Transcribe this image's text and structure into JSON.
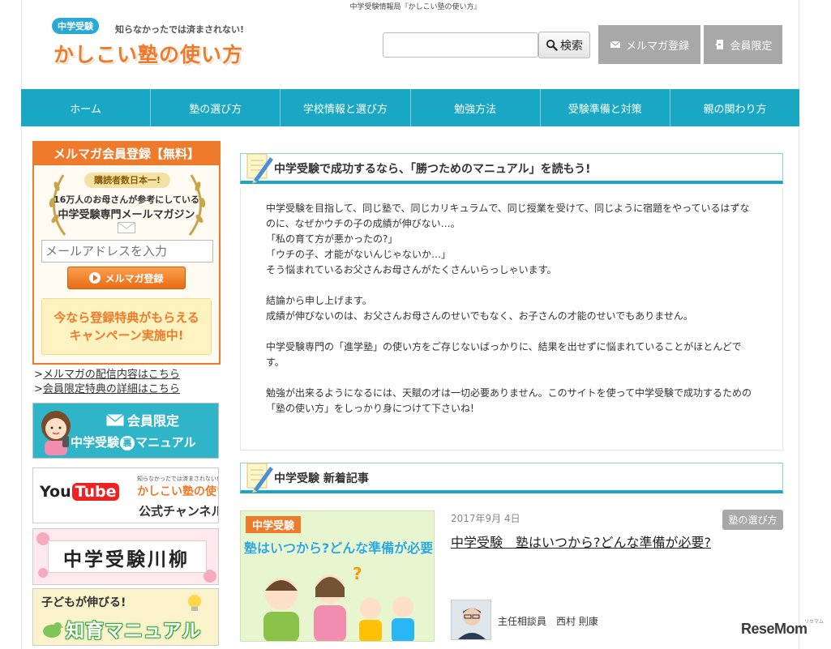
{
  "header": {
    "tagline": "中学受験情報局『かしこい塾の使い方』",
    "logo": {
      "badge": "中学受験",
      "catch": "知らなかったでは済まされない!",
      "name": "かしこい塾の使い方"
    },
    "search": {
      "placeholder": "",
      "button_label": "検索"
    },
    "mail_button": "メルマガ登録",
    "member_button": "会員限定"
  },
  "nav": {
    "items": [
      {
        "label": "ホーム"
      },
      {
        "label": "塾の選び方"
      },
      {
        "label": "学校情報と選び方"
      },
      {
        "label": "勉強方法"
      },
      {
        "label": "受験準備と対策"
      },
      {
        "label": "親の関わり方"
      }
    ]
  },
  "sidebar": {
    "register": {
      "title": "メルマガ会員登録【無料】",
      "no1": "購読者数日本一!",
      "line1": "16万人のお母さんが参考にしている",
      "line2": "中学受験専門メールマガジン",
      "email_placeholder": "メールアドレスを入力",
      "submit": "メルマガ登録",
      "promo_line1": "今なら登録特典がもらえる",
      "promo_line2": "キャンペーン実施中!"
    },
    "links": [
      {
        "prefix": ">",
        "label": "メルマガの配信内容はこちら"
      },
      {
        "prefix": ">",
        "label": "会員限定特典の詳細はこちら"
      }
    ],
    "banner_manual": {
      "line1": "会員限定",
      "line2_a": "中学受験",
      "line2_ura": "裏",
      "line2_b": "マニュアル"
    },
    "banner_youtube": {
      "you": "You",
      "tube": "Tube",
      "mini1": "知らなかったでは済まされない!",
      "mini2": "かしこい塾の使い方",
      "channel": "公式チャンネル"
    },
    "banner_senryu": {
      "text": "中学受験川柳"
    },
    "banner_chiiku": {
      "line1": "子どもが伸びる!",
      "line2": "知育マニュアル"
    }
  },
  "main": {
    "intro": {
      "heading": "中学受験で成功するなら、「勝つためのマニュアル」を読もう!",
      "paragraphs": [
        [
          "中学受験を目指して、同じ塾で、同じカリキュラムで、同じ授業を受けて、同じように宿題をやっているはずなのに、なぜかウチの子の成績が伸びない…。",
          "「私の育て方が悪かったの?」",
          "「ウチの子、才能がないんじゃないか…」",
          "そう悩まれているお父さんお母さんがたくさんいらっしゃいます。"
        ],
        [
          "結論から申し上げます。",
          "成績が伸びないのは、お父さんお母さんのせいでもなく、お子さんの才能のせいでもありません。"
        ],
        [
          "中学受験専門の「進学塾」の使い方をご存じないばっかりに、結果を出せずに悩まれていることがほとんどです。"
        ],
        [
          "勉強が出来るようになるには、天賦の才は一切必要ありません。このサイトを使って中学受験で成功するための「塾の使い方」をしっかり身につけて下さいね!"
        ]
      ]
    },
    "news": {
      "heading": "中学受験 新着記事",
      "article": {
        "thumb_tag": "中学受験",
        "thumb_headline": "塾はいつから?どんな準備が必要?",
        "date": "2017年9月 4日",
        "category": "塾の選び方",
        "title": "中学受験　塾はいつから?どんな準備が必要?",
        "author": "主任相談員　西村 則康"
      }
    }
  },
  "watermark": {
    "text": "ReseMom",
    "small": "リセマム"
  },
  "colors": {
    "accent": "#1aa7c3",
    "orange": "#ee7a2b",
    "gray_button": "#a8a8a8"
  }
}
